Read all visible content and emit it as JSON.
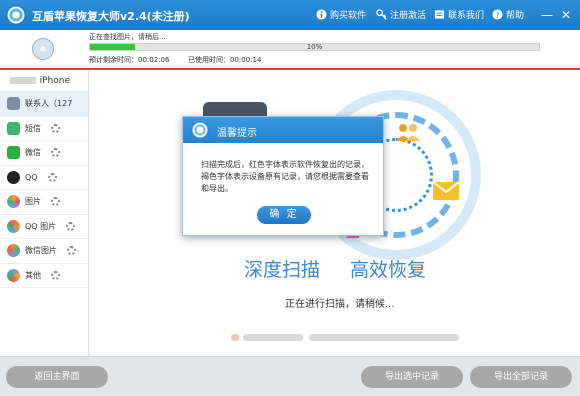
{
  "window": {
    "title": "互盾苹果恢复大师v2.4(未注册)",
    "buy_label": "购买软件",
    "register_label": "注册激活",
    "contact_label": "联系我们",
    "help_label": "帮助",
    "minimize_glyph": "—",
    "close_glyph": "✕"
  },
  "scan": {
    "status": "正在查找图片，请稍后...",
    "progress_text": "10%",
    "progress_value": 0.1,
    "remaining_label": "预计剩余时间：",
    "remaining_value": "00:02:06",
    "elapsed_label": "已使用时间：",
    "elapsed_value": "00:00:14"
  },
  "sidebar": {
    "device_label": "iPhone",
    "items": [
      {
        "label": "联系人（12",
        "count": "7",
        "icon": "contacts-icon",
        "color": "#7a8fa6",
        "loading": false
      },
      {
        "label": "短信",
        "icon": "sms-icon",
        "color": "#3cb371",
        "loading": true
      },
      {
        "label": "微信",
        "icon": "wechat-icon",
        "color": "#2aae3f",
        "loading": true
      },
      {
        "label": "QQ",
        "icon": "qq-icon",
        "color": "#222222",
        "loading": true
      },
      {
        "label": "图片",
        "icon": "photos-icon",
        "color": "#f0a030",
        "loading": true
      },
      {
        "label": "QQ 图片",
        "icon": "qq-photos-icon",
        "color": "#e95b5b",
        "loading": true
      },
      {
        "label": "微信图片",
        "icon": "wechat-photos-icon",
        "color": "#e98a3b",
        "loading": true
      },
      {
        "label": "其他",
        "icon": "other-icon",
        "color": "#6a9be0",
        "loading": true
      }
    ]
  },
  "main": {
    "hero_left": "深度扫描",
    "hero_right": "高效恢复",
    "scanning_text": "正在进行扫描，请稍候..."
  },
  "dialog": {
    "title": "温馨提示",
    "message": "扫描完成后，红色字体表示软件恢复出的记录，褐色字体表示设备原有记录，请您根据需要查看和导出。",
    "ok_label": "确 定"
  },
  "bottom": {
    "back_label": "返回主界面",
    "export_selected_label": "导出选中记录",
    "export_all_label": "导出全部记录"
  },
  "colors": {
    "accent": "#2583cf",
    "progress": "#3fc23f",
    "divider": "#e33b3b"
  }
}
